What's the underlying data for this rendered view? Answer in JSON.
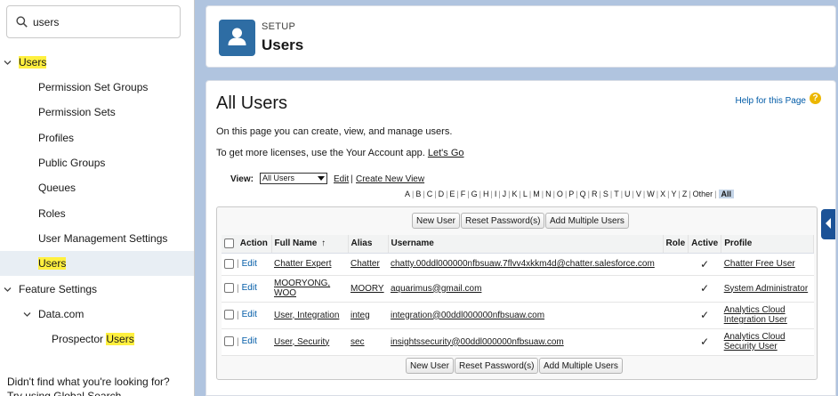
{
  "sidebar": {
    "search": {
      "value": "users",
      "placeholder": "Quick Find"
    },
    "tree": [
      {
        "label": "Users",
        "highlight": "Users",
        "prefix": "",
        "suffix": "",
        "expanded": true,
        "level": 0
      },
      {
        "label": "Permission Set Groups",
        "level": 1
      },
      {
        "label": "Permission Sets",
        "level": 1
      },
      {
        "label": "Profiles",
        "level": 1
      },
      {
        "label": "Public Groups",
        "level": 1
      },
      {
        "label": "Queues",
        "level": 1
      },
      {
        "label": "Roles",
        "level": 1
      },
      {
        "label": "User Management Settings",
        "level": 1
      },
      {
        "label": "Users",
        "highlight": "Users",
        "level": 1,
        "selected": true
      },
      {
        "label": "Feature Settings",
        "level": 0,
        "expanded": true
      },
      {
        "label": "Data.com",
        "level": 1,
        "expanded": true
      },
      {
        "label": "Prospector Users",
        "prefix": "Prospector ",
        "highlight": "Users",
        "level": 2
      }
    ],
    "footer": "Didn't find what you're looking for?",
    "footer2": "Try using Global Search."
  },
  "header": {
    "eyebrow": "SETUP",
    "title": "Users",
    "icon": "user-icon"
  },
  "main": {
    "title": "All Users",
    "help_link": "Help for this Page",
    "desc1": "On this page you can create, view, and manage users.",
    "desc2_prefix": "To get more licenses, use the Your Account app.",
    "desc2_link": "Let's Go",
    "view_label": "View:",
    "view_selected": "All Users",
    "edit_link": "Edit",
    "view_sep": "|",
    "create_view_link": "Create New View",
    "alphabet": [
      "A",
      "B",
      "C",
      "D",
      "E",
      "F",
      "G",
      "H",
      "I",
      "J",
      "K",
      "L",
      "M",
      "N",
      "O",
      "P",
      "Q",
      "R",
      "S",
      "T",
      "U",
      "V",
      "W",
      "X",
      "Y",
      "Z",
      "Other"
    ],
    "alphabet_all": "All",
    "buttons": {
      "new_user": "New User",
      "reset_password": "Reset Password(s)",
      "add_multiple": "Add Multiple Users"
    },
    "columns": {
      "action": "Action",
      "full_name": "Full Name",
      "sort_indicator": "↑",
      "alias": "Alias",
      "username": "Username",
      "role": "Role",
      "active": "Active",
      "profile": "Profile"
    },
    "row_edit": "Edit",
    "rows": [
      {
        "full_name": "Chatter Expert",
        "alias": "Chatter",
        "username": "chatty.00ddl000000nfbsuaw.7flvv4xkkm4d@chatter.salesforce.com",
        "role": "",
        "active": "✓",
        "profile": "Chatter Free User"
      },
      {
        "full_name": "MOORYONG, WOO",
        "alias": "MOORY",
        "username": "aquarimus@gmail.com",
        "role": "",
        "active": "✓",
        "profile": "System Administrator"
      },
      {
        "full_name": "User, Integration",
        "alias": "integ",
        "username": "integration@00ddl000000nfbsuaw.com",
        "role": "",
        "active": "✓",
        "profile": "Analytics Cloud Integration User"
      },
      {
        "full_name": "User, Security",
        "alias": "sec",
        "username": "insightssecurity@00ddl000000nfbsuaw.com",
        "role": "",
        "active": "✓",
        "profile": "Analytics Cloud Security User"
      }
    ]
  },
  "colors": {
    "accent": "#2e6da4",
    "link": "#015ba7",
    "highlight": "#fff03f",
    "selected_row": "#e8eef4",
    "background": "#b0c4df"
  }
}
